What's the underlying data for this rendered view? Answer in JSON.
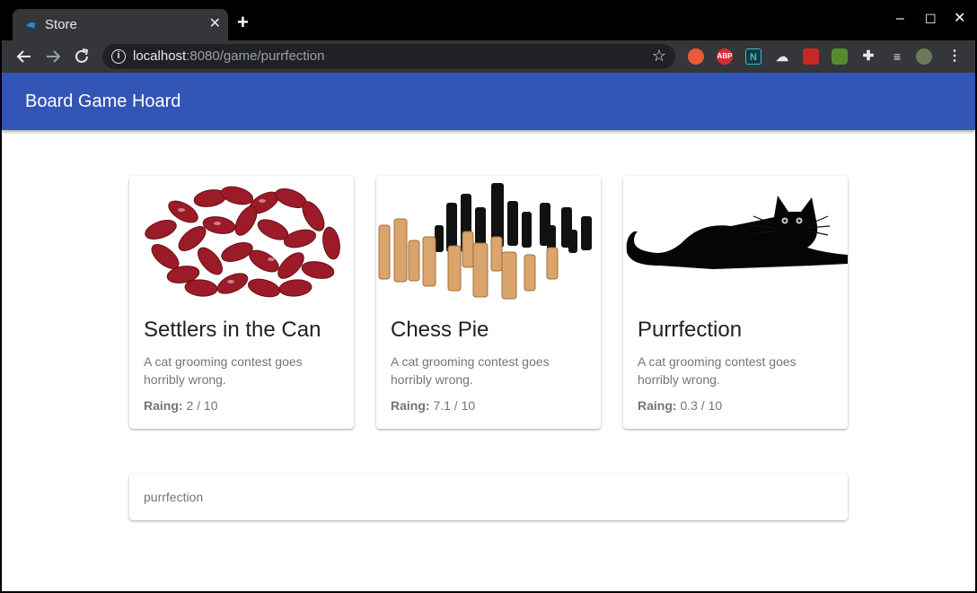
{
  "browser": {
    "tab_title": "Store",
    "tab_close_glyph": "✕",
    "new_tab_glyph": "+",
    "url_host": "localhost",
    "url_path": ":8080/game/purrfection",
    "ext_abp": "ABP",
    "ext_n": "N",
    "window_controls": {
      "minimize": "–",
      "maximize": "☐",
      "close": "✕"
    }
  },
  "app": {
    "title": "Board Game Hoard",
    "colors": {
      "appbar": "#3255b6",
      "card_text": "#757575"
    }
  },
  "cards": [
    {
      "title": "Settlers in the Can",
      "description": "A cat grooming contest goes horribly wrong.",
      "rating_label": "Raing:",
      "rating_value": "2 / 10",
      "image": "kidney-beans"
    },
    {
      "title": "Chess Pie",
      "description": "A cat grooming contest goes horribly wrong.",
      "rating_label": "Raing:",
      "rating_value": "7.1 / 10",
      "image": "chess-pieces"
    },
    {
      "title": "Purrfection",
      "description": "A cat grooming contest goes horribly wrong.",
      "rating_label": "Raing:",
      "rating_value": "0.3 / 10",
      "image": "black-cat"
    }
  ],
  "search": {
    "value": "purrfection"
  }
}
